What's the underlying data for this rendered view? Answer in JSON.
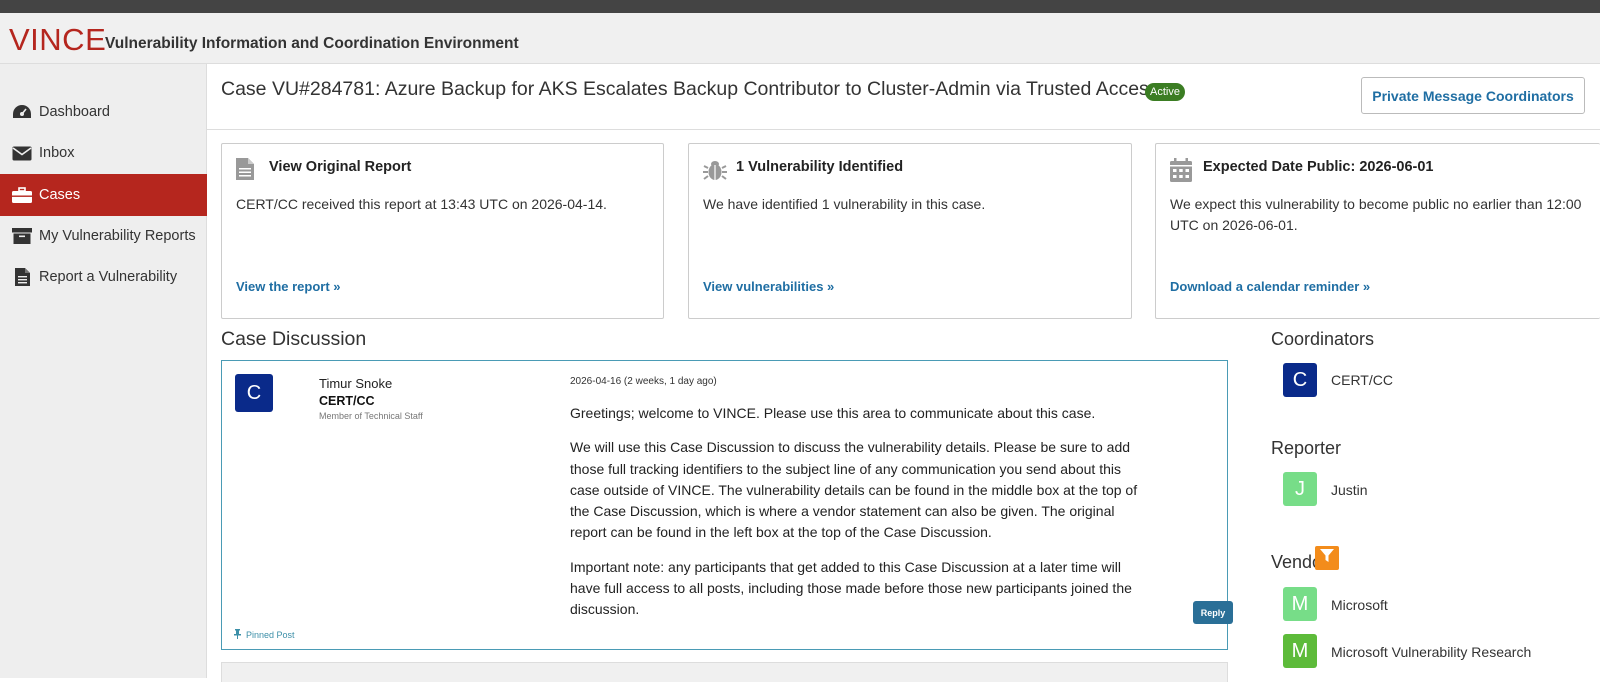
{
  "app": {
    "logo": "VINCE",
    "tagline": "Vulnerability Information and Coordination Environment"
  },
  "sidebar": {
    "items": [
      {
        "label": "Dashboard",
        "icon": "dashboard-icon"
      },
      {
        "label": "Inbox",
        "icon": "envelope-icon"
      },
      {
        "label": "Cases",
        "icon": "briefcase-icon",
        "active": true
      },
      {
        "label": "My Vulnerability Reports",
        "icon": "archive-icon"
      },
      {
        "label": "Report a Vulnerability",
        "icon": "document-icon"
      }
    ]
  },
  "case": {
    "title": "Case VU#284781: Azure Backup for AKS Escalates Backup Contributor to Cluster-Admin via Trusted Access",
    "status": "Active",
    "pm_button": "Private Message Coordinators"
  },
  "cards": [
    {
      "icon": "document-icon",
      "title": "View Original Report",
      "body": "CERT/CC received this report at 13:43 UTC on 2026-04-14.",
      "link": "View the report »"
    },
    {
      "icon": "bug-icon",
      "title": "1 Vulnerability Identified",
      "body": "We have identified 1 vulnerability in this case.",
      "link": "View vulnerabilities »"
    },
    {
      "icon": "calendar-icon",
      "title": "Expected Date Public: 2026-06-01",
      "body": "We expect this vulnerability to become public no earlier than 12:00 UTC on 2026-06-01.",
      "link": "Download a calendar reminder »"
    }
  ],
  "discussion": {
    "heading": "Case Discussion",
    "post": {
      "avatar_letter": "C",
      "author": "Timur Snoke",
      "org": "CERT/CC",
      "role": "Member of Technical Staff",
      "date": "2026-04-16 (2 weeks, 1 day ago)",
      "paragraphs": [
        "Greetings; welcome to VINCE. Please use this area to communicate about this case.",
        "We will use this Case Discussion to discuss the vulnerability details. Please be sure to add those full tracking identifiers to the subject line of any communication you send about this case outside of VINCE. The vulnerability details can be found in the middle box at the top of the Case Discussion, which is where a vendor statement can also be given. The original report can be found in the left box at the top of the Case Discussion.",
        "Important note: any participants that get added to this Case Discussion at a later time will have full access to all posts, including those made before those new participants joined the discussion."
      ],
      "reply_label": "Reply",
      "pinned_label": "Pinned Post"
    }
  },
  "right": {
    "coordinators_heading": "Coordinators",
    "coordinators": [
      {
        "letter": "C",
        "name": "CERT/CC"
      }
    ],
    "reporter_heading": "Reporter",
    "reporter": {
      "letter": "J",
      "name": "Justin"
    },
    "vendors_heading": "Vendors",
    "vendors": [
      {
        "letter": "M",
        "name": "Microsoft"
      },
      {
        "letter": "M",
        "name": "Microsoft Vulnerability Research"
      }
    ]
  },
  "colors": {
    "brand": "#b5261e",
    "link": "#1f6ea3",
    "badge": "#3b7d23",
    "avatar_blue": "#0a2a8a",
    "avatar_green_light": "#77dd88",
    "avatar_green": "#5dbb3a",
    "filter": "#f38c1b"
  }
}
